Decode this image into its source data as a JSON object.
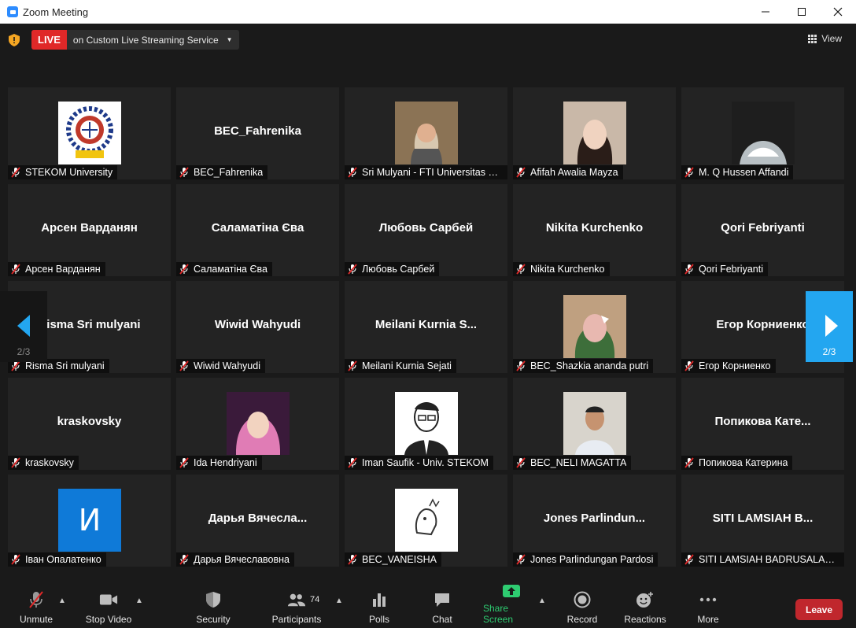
{
  "window": {
    "title": "Zoom Meeting"
  },
  "topbar": {
    "live_label": "LIVE",
    "live_text": "on Custom Live Streaming Service",
    "view_label": "View"
  },
  "tiles": [
    {
      "big": "",
      "caption": "STEKOM University",
      "photo": "logo-stekom"
    },
    {
      "big": "BEC_Fahrenika",
      "caption": "BEC_Fahrenika",
      "photo": ""
    },
    {
      "big": "",
      "caption": "Sri Mulyani - FTI Universitas S...",
      "photo": "person-hijab"
    },
    {
      "big": "",
      "caption": "Afifah Awalia Mayza",
      "photo": "person-girl"
    },
    {
      "big": "",
      "caption": "M. Q Hussen Affandi",
      "photo": "person-hood"
    },
    {
      "big": "Арсен Варданян",
      "caption": "Арсен Варданян",
      "photo": ""
    },
    {
      "big": "Саламатіна Єва",
      "caption": "Саламатіна Єва",
      "photo": ""
    },
    {
      "big": "Любовь Сарбей",
      "caption": "Любовь Сарбей",
      "photo": ""
    },
    {
      "big": "Nikita Kurchenko",
      "caption": "Nikita Kurchenko",
      "photo": ""
    },
    {
      "big": "Qori Febriyanti",
      "caption": "Qori Febriyanti",
      "photo": ""
    },
    {
      "big": "Risma Sri mulyani",
      "caption": "Risma Sri mulyani",
      "photo": ""
    },
    {
      "big": "Wiwid Wahyudi",
      "caption": "Wiwid Wahyudi",
      "photo": ""
    },
    {
      "big": "Meilani  Kurnia  S...",
      "caption": "Meilani Kurnia Sejati",
      "photo": ""
    },
    {
      "big": "",
      "caption": "BEC_Shazkia ananda putri",
      "photo": "person-blur"
    },
    {
      "big": "Егор Корниенко",
      "caption": "Егор Корниенко",
      "photo": ""
    },
    {
      "big": "kraskovsky",
      "caption": "kraskovsky",
      "photo": ""
    },
    {
      "big": "",
      "caption": "Ida Hendriyani",
      "photo": "person-pink"
    },
    {
      "big": "",
      "caption": "Iman Saufik - Univ. STEKOM",
      "photo": "person-sketch"
    },
    {
      "big": "",
      "caption": "BEC_NELI MAGATTA",
      "photo": "person-shirt"
    },
    {
      "big": "Попикова  Кате...",
      "caption": "Попикова Катерина",
      "photo": ""
    },
    {
      "big": "",
      "caption": "Іван Опалатенко",
      "photo": "initial-avatar",
      "initial": "И"
    },
    {
      "big": "Дарья  Вячесла...",
      "caption": "Дарья Вячеславовна",
      "photo": ""
    },
    {
      "big": "",
      "caption": "BEC_VANEISHA",
      "photo": "sketch-doodle"
    },
    {
      "big": "Jones  Parlindun...",
      "caption": "Jones Parlindungan Pardosi",
      "photo": ""
    },
    {
      "big": "SITI LAMSIAH  B...",
      "caption": "SITI LAMSIAH BADRUSALAM ...",
      "photo": ""
    }
  ],
  "pager": {
    "left": "2/3",
    "right": "2/3"
  },
  "toolbar": {
    "unmute": "Unmute",
    "stop_video": "Stop Video",
    "security": "Security",
    "participants": "Participants",
    "participants_count": "74",
    "polls": "Polls",
    "chat": "Chat",
    "share_screen": "Share Screen",
    "record": "Record",
    "reactions": "Reactions",
    "more": "More",
    "leave": "Leave"
  },
  "colors": {
    "accent": "#23a6f0",
    "live": "#e02828",
    "share": "#2ecc71",
    "leave": "#c0272d"
  }
}
